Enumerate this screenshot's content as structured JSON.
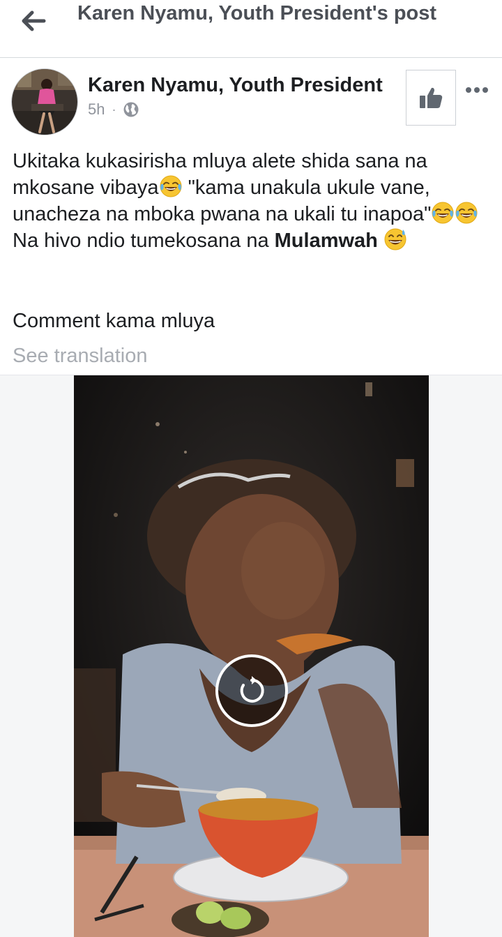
{
  "header": {
    "title": "Karen Nyamu, Youth President's post"
  },
  "post": {
    "author": "Karen Nyamu, Youth President",
    "time": "5h",
    "separator": "·",
    "text": {
      "part1": "Ukitaka kukasirisha mluya alete shida sana na mkosane vibaya",
      "part2": " \"kama unakula ukule vane, unacheza na mboka pwana na ukali tu inapoa\"",
      "part3": " Na hivo ndio tumekosana na ",
      "mention": "Mulamwah",
      "comment": "Comment kama mluya"
    },
    "see_translation": "See translation"
  },
  "icons": {
    "back": "arrow-left-icon",
    "privacy": "globe-icon",
    "like": "thumbs-up-icon",
    "more": "more-horizontal-icon",
    "replay": "replay-icon",
    "emoji_laugh": "tears-of-joy-emoji",
    "emoji_sweat": "grinning-sweat-emoji"
  },
  "colors": {
    "header_text": "#4b4f56",
    "meta_text": "#90949c",
    "translation_text": "#a8acb2",
    "body_text": "#1c1e21"
  }
}
